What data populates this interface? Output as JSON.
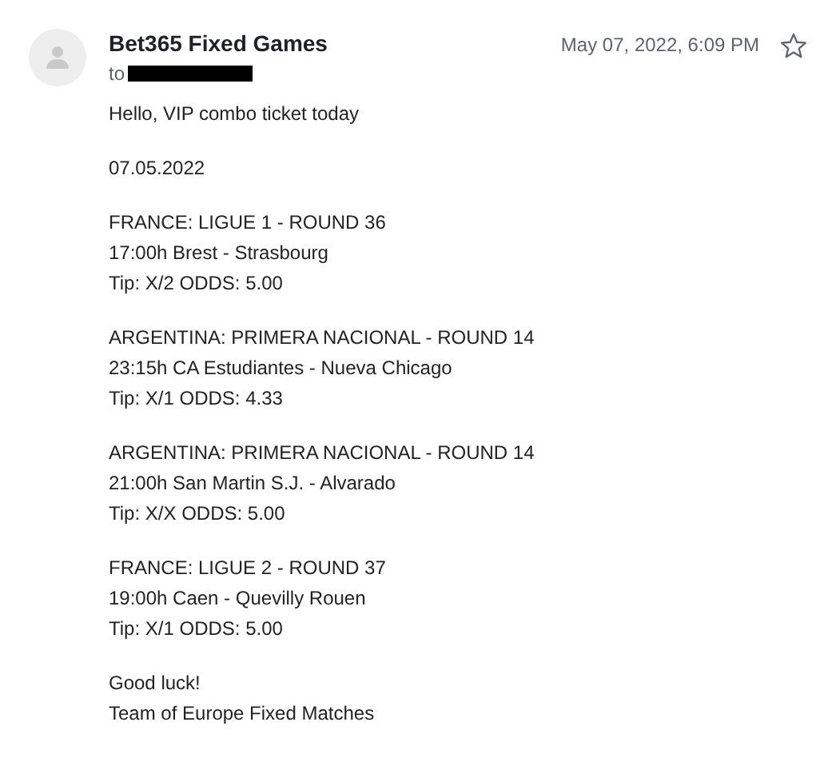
{
  "sender": "Bet365 Fixed Games",
  "to_label": "to",
  "date": "May 07, 2022, 6:09 PM",
  "starred": false,
  "paragraphs": [
    [
      "Hello, VIP combo ticket today"
    ],
    [
      "07.05.2022"
    ],
    [
      "FRANCE: LIGUE 1 - ROUND 36",
      "17:00h Brest - Strasbourg",
      "Tip: X/2 ODDS: 5.00"
    ],
    [
      "ARGENTINA: PRIMERA NACIONAL - ROUND 14",
      "23:15h CA Estudiantes - Nueva Chicago",
      "Tip: X/1 ODDS: 4.33"
    ],
    [
      "ARGENTINA: PRIMERA NACIONAL - ROUND 14",
      "21:00h San Martin S.J. - Alvarado",
      "Tip: X/X ODDS: 5.00"
    ],
    [
      "FRANCE: LIGUE 2 - ROUND 37",
      "19:00h Caen - Quevilly Rouen",
      "Tip: X/1 ODDS: 5.00"
    ],
    [
      "Good luck!",
      "Team of Europe Fixed Matches"
    ]
  ]
}
